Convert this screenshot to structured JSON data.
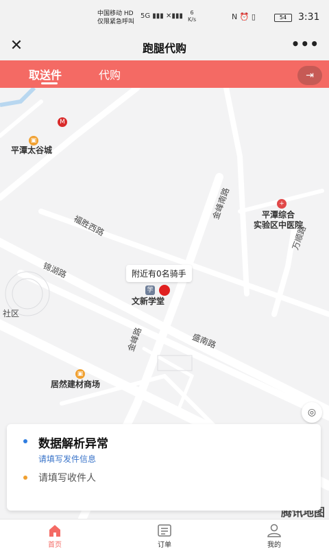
{
  "status_bar": {
    "carrier_line1": "中国移动 HD",
    "carrier_line2": "仅限紧急呼叫",
    "signal": "5G ▮▮▮ ✕▮▮▮",
    "net_speed": "6",
    "net_speed_unit": "K/s",
    "right_icons": "N ⏰ ▯",
    "battery": "54",
    "time": "3:31"
  },
  "titlebar": {
    "close_icon": "✕",
    "title": "跑腿代购",
    "more_icon": "•••"
  },
  "tabs": [
    {
      "label": "取送件",
      "active": true
    },
    {
      "label": "代购",
      "active": false
    }
  ],
  "map": {
    "labels": {
      "pingtan_taigu": "平潭太谷城",
      "fusheng_road": "福胜西路",
      "jinhu_road": "锦湖路",
      "jinfeng_road_n": "金峰南路",
      "jinfeng_road_s": "金峰路",
      "shengnan_road": "盛南路",
      "hospital": "平潭综合\n实验区中医院",
      "wanshun_road": "万顺路",
      "community": "社区",
      "juran": "居然建材商场",
      "wenxin": "文新学堂"
    },
    "riders_bubble": "附近有0名骑手",
    "map_logo": "腾讯地图"
  },
  "card": {
    "title": "数据解析异常",
    "sender_link": "请填写发件信息",
    "receiver": "请填写收件人"
  },
  "bottom_nav": [
    {
      "label": "首页",
      "active": true
    },
    {
      "label": "订单",
      "active": false
    },
    {
      "label": "我的",
      "active": false
    }
  ],
  "colors": {
    "accent": "#f46a64",
    "link": "#3a74c9",
    "pin": "#e02020",
    "sender_dot": "#2f7de0",
    "receiver_dot": "#f0a030"
  }
}
